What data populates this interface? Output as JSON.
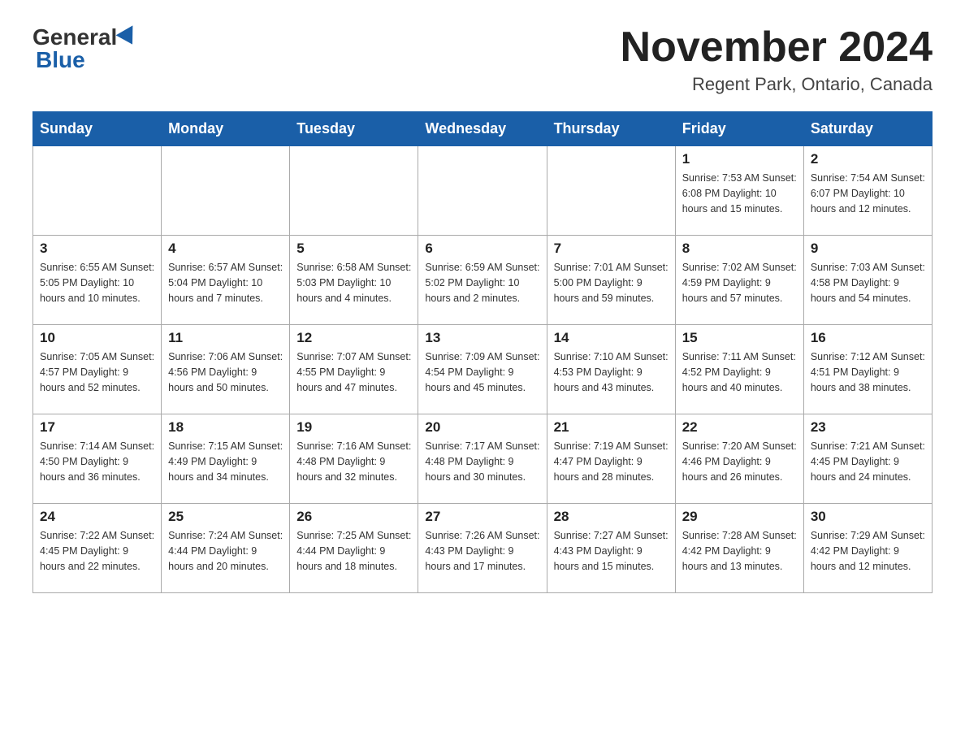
{
  "header": {
    "logo_general": "General",
    "logo_blue": "Blue",
    "month_title": "November 2024",
    "location": "Regent Park, Ontario, Canada"
  },
  "days_of_week": [
    "Sunday",
    "Monday",
    "Tuesday",
    "Wednesday",
    "Thursday",
    "Friday",
    "Saturday"
  ],
  "weeks": [
    [
      {
        "day": "",
        "info": ""
      },
      {
        "day": "",
        "info": ""
      },
      {
        "day": "",
        "info": ""
      },
      {
        "day": "",
        "info": ""
      },
      {
        "day": "",
        "info": ""
      },
      {
        "day": "1",
        "info": "Sunrise: 7:53 AM\nSunset: 6:08 PM\nDaylight: 10 hours\nand 15 minutes."
      },
      {
        "day": "2",
        "info": "Sunrise: 7:54 AM\nSunset: 6:07 PM\nDaylight: 10 hours\nand 12 minutes."
      }
    ],
    [
      {
        "day": "3",
        "info": "Sunrise: 6:55 AM\nSunset: 5:05 PM\nDaylight: 10 hours\nand 10 minutes."
      },
      {
        "day": "4",
        "info": "Sunrise: 6:57 AM\nSunset: 5:04 PM\nDaylight: 10 hours\nand 7 minutes."
      },
      {
        "day": "5",
        "info": "Sunrise: 6:58 AM\nSunset: 5:03 PM\nDaylight: 10 hours\nand 4 minutes."
      },
      {
        "day": "6",
        "info": "Sunrise: 6:59 AM\nSunset: 5:02 PM\nDaylight: 10 hours\nand 2 minutes."
      },
      {
        "day": "7",
        "info": "Sunrise: 7:01 AM\nSunset: 5:00 PM\nDaylight: 9 hours\nand 59 minutes."
      },
      {
        "day": "8",
        "info": "Sunrise: 7:02 AM\nSunset: 4:59 PM\nDaylight: 9 hours\nand 57 minutes."
      },
      {
        "day": "9",
        "info": "Sunrise: 7:03 AM\nSunset: 4:58 PM\nDaylight: 9 hours\nand 54 minutes."
      }
    ],
    [
      {
        "day": "10",
        "info": "Sunrise: 7:05 AM\nSunset: 4:57 PM\nDaylight: 9 hours\nand 52 minutes."
      },
      {
        "day": "11",
        "info": "Sunrise: 7:06 AM\nSunset: 4:56 PM\nDaylight: 9 hours\nand 50 minutes."
      },
      {
        "day": "12",
        "info": "Sunrise: 7:07 AM\nSunset: 4:55 PM\nDaylight: 9 hours\nand 47 minutes."
      },
      {
        "day": "13",
        "info": "Sunrise: 7:09 AM\nSunset: 4:54 PM\nDaylight: 9 hours\nand 45 minutes."
      },
      {
        "day": "14",
        "info": "Sunrise: 7:10 AM\nSunset: 4:53 PM\nDaylight: 9 hours\nand 43 minutes."
      },
      {
        "day": "15",
        "info": "Sunrise: 7:11 AM\nSunset: 4:52 PM\nDaylight: 9 hours\nand 40 minutes."
      },
      {
        "day": "16",
        "info": "Sunrise: 7:12 AM\nSunset: 4:51 PM\nDaylight: 9 hours\nand 38 minutes."
      }
    ],
    [
      {
        "day": "17",
        "info": "Sunrise: 7:14 AM\nSunset: 4:50 PM\nDaylight: 9 hours\nand 36 minutes."
      },
      {
        "day": "18",
        "info": "Sunrise: 7:15 AM\nSunset: 4:49 PM\nDaylight: 9 hours\nand 34 minutes."
      },
      {
        "day": "19",
        "info": "Sunrise: 7:16 AM\nSunset: 4:48 PM\nDaylight: 9 hours\nand 32 minutes."
      },
      {
        "day": "20",
        "info": "Sunrise: 7:17 AM\nSunset: 4:48 PM\nDaylight: 9 hours\nand 30 minutes."
      },
      {
        "day": "21",
        "info": "Sunrise: 7:19 AM\nSunset: 4:47 PM\nDaylight: 9 hours\nand 28 minutes."
      },
      {
        "day": "22",
        "info": "Sunrise: 7:20 AM\nSunset: 4:46 PM\nDaylight: 9 hours\nand 26 minutes."
      },
      {
        "day": "23",
        "info": "Sunrise: 7:21 AM\nSunset: 4:45 PM\nDaylight: 9 hours\nand 24 minutes."
      }
    ],
    [
      {
        "day": "24",
        "info": "Sunrise: 7:22 AM\nSunset: 4:45 PM\nDaylight: 9 hours\nand 22 minutes."
      },
      {
        "day": "25",
        "info": "Sunrise: 7:24 AM\nSunset: 4:44 PM\nDaylight: 9 hours\nand 20 minutes."
      },
      {
        "day": "26",
        "info": "Sunrise: 7:25 AM\nSunset: 4:44 PM\nDaylight: 9 hours\nand 18 minutes."
      },
      {
        "day": "27",
        "info": "Sunrise: 7:26 AM\nSunset: 4:43 PM\nDaylight: 9 hours\nand 17 minutes."
      },
      {
        "day": "28",
        "info": "Sunrise: 7:27 AM\nSunset: 4:43 PM\nDaylight: 9 hours\nand 15 minutes."
      },
      {
        "day": "29",
        "info": "Sunrise: 7:28 AM\nSunset: 4:42 PM\nDaylight: 9 hours\nand 13 minutes."
      },
      {
        "day": "30",
        "info": "Sunrise: 7:29 AM\nSunset: 4:42 PM\nDaylight: 9 hours\nand 12 minutes."
      }
    ]
  ]
}
